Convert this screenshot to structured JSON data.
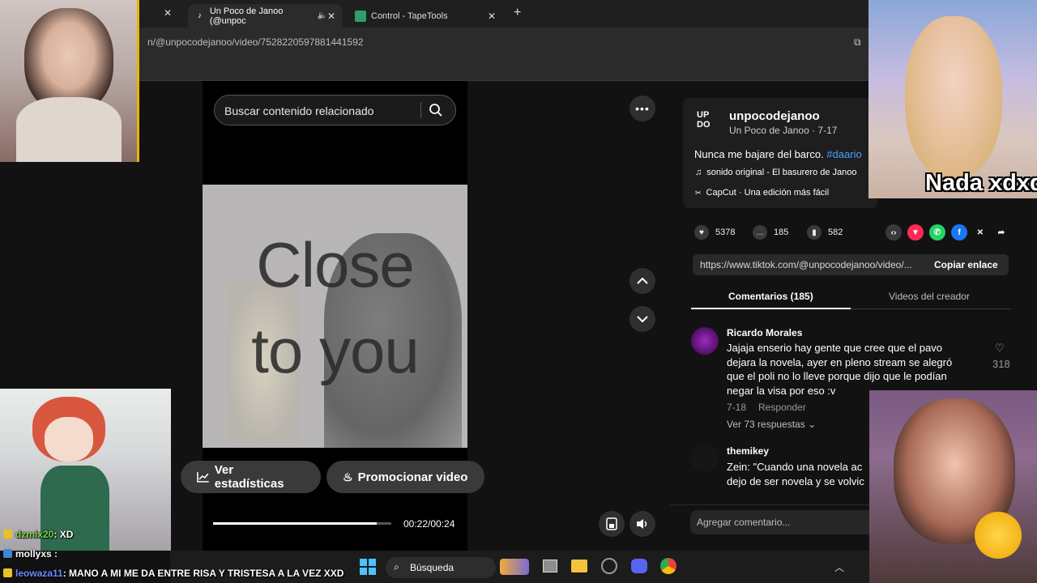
{
  "browser": {
    "tabs": [
      {
        "label": "Un Poco de Janoo (@unpoc",
        "active": true
      },
      {
        "label": "Control - TapeTools",
        "active": false
      }
    ],
    "address": "n/@unpocodejanoo/video/7528220597881441592"
  },
  "video": {
    "search_placeholder": "Buscar contenido relacionado",
    "overlay_line1": "Close",
    "overlay_line2": "to you",
    "stats_button": "Ver estadísticas",
    "promote_button": "Promocionar video",
    "time": "00:22/00:24",
    "progress": 0.92
  },
  "post": {
    "username": "unpocodejanoo",
    "display_line": "Un Poco de Janoo · 7-17",
    "caption": "Nunca me bajare del barco.",
    "hashtag": "#daario",
    "sound": "sonido original - El basurero de Janoo",
    "capcut": "CapCut · Una edición más fácil",
    "likes": "5378",
    "comments": "185",
    "saves": "582",
    "link": "https://www.tiktok.com/@unpocodejanoo/video/...",
    "copy_link": "Copiar enlace"
  },
  "comments_tabs": {
    "comments": "Comentarios (185)",
    "creator_videos": "Videos del creador"
  },
  "comments": [
    {
      "author": "Ricardo Morales",
      "text_l1": "Jajaja enserio hay gente que cree que el pavo",
      "text_l2": "dejara la novela, ayer en pleno stream se alegró",
      "text_l3": "que el poli no lo lleve porque dijo que le podían",
      "text_l4": "negar la visa por eso :v",
      "date": "7-18",
      "reply": "Responder",
      "likes": "318",
      "view_replies": "Ver 73 respuestas"
    },
    {
      "author": "themikey",
      "text_l1": "Zein: \"Cuando una novela ac",
      "text_l2": "dejo de ser novela y se volvic"
    }
  ],
  "comment_input": "Agregar comentario...",
  "taskbar": {
    "search": "Búsqueda"
  },
  "overlay_caption": "Nada xdxd",
  "chat": [
    {
      "user": "dzmix20",
      "msg": ": XD",
      "color": "#7cd34a"
    },
    {
      "user": "mollyxs",
      "msg": ":",
      "color": "#ffffff"
    },
    {
      "user": "leowaza11",
      "msg": ": MANO A MI ME DA ENTRE RISA Y TRISTESA A LA VEZ XXD",
      "color": "#6b8cff"
    }
  ]
}
